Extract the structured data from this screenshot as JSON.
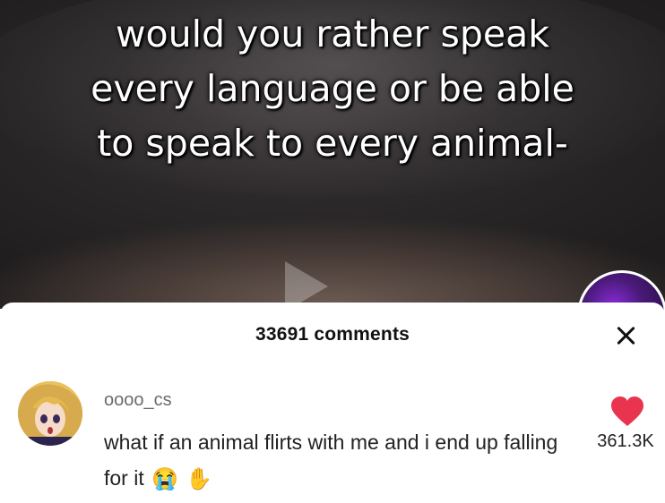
{
  "video": {
    "caption_lines": [
      "would you rather speak",
      "every language or be able",
      "to speak to every animal-"
    ]
  },
  "comments_panel": {
    "count_label": "33691 comments",
    "close_icon": "close-icon"
  },
  "comment": {
    "username": "oooo_cs",
    "text": "what if an animal flirts with me and i end up falling for it",
    "emojis": [
      "😭",
      "✋"
    ],
    "likes": "361.3K",
    "like_icon": "heart-icon",
    "like_color": "#e8344f"
  }
}
